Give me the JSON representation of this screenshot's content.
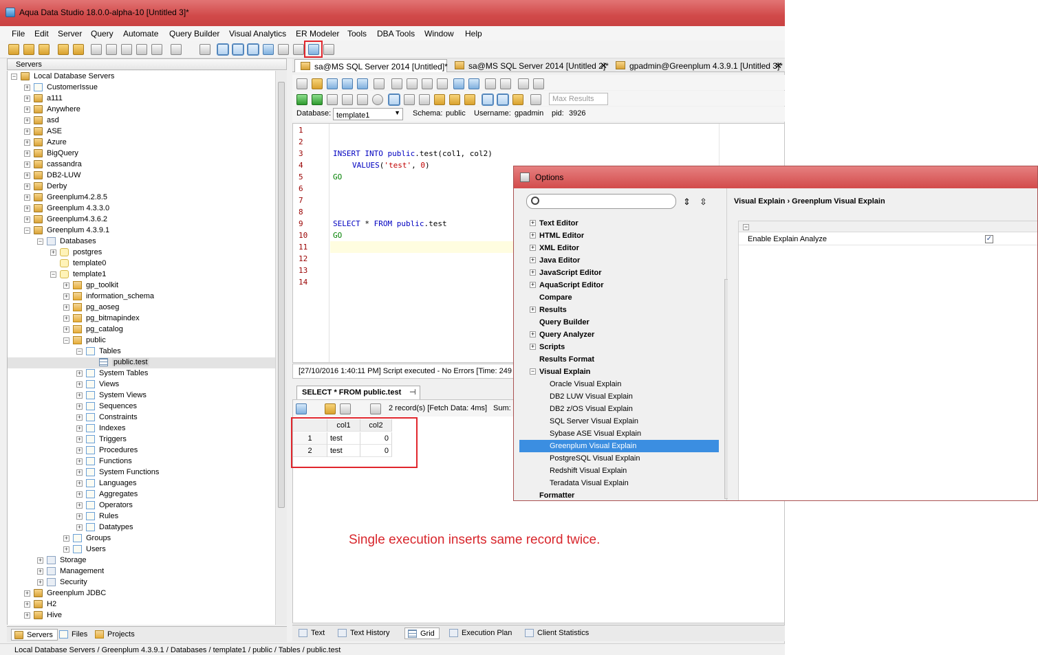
{
  "window": {
    "title": "Aqua Data Studio 18.0.0-alpha-10 [Untitled 3]*"
  },
  "menu": [
    "File",
    "Edit",
    "Server",
    "Query",
    "Automate",
    "Query Builder",
    "Visual Analytics",
    "ER Modeler",
    "Tools",
    "DBA Tools",
    "Window",
    "Help"
  ],
  "left_panel": {
    "header": "Servers",
    "tree": [
      {
        "label": "Local Database Servers",
        "level": 0,
        "icon": "server-group"
      },
      {
        "label": "CustomerIssue",
        "level": 1,
        "icon": "folder"
      },
      {
        "label": "a111",
        "level": 1,
        "icon": "server"
      },
      {
        "label": "Anywhere",
        "level": 1,
        "icon": "server"
      },
      {
        "label": "asd",
        "level": 1,
        "icon": "server"
      },
      {
        "label": "ASE",
        "level": 1,
        "icon": "server"
      },
      {
        "label": "Azure",
        "level": 1,
        "icon": "server"
      },
      {
        "label": "BigQuery",
        "level": 1,
        "icon": "server"
      },
      {
        "label": "cassandra",
        "level": 1,
        "icon": "server"
      },
      {
        "label": "DB2-LUW",
        "level": 1,
        "icon": "server"
      },
      {
        "label": "Derby",
        "level": 1,
        "icon": "server"
      },
      {
        "label": "Greenplum4.2.8.5",
        "level": 1,
        "icon": "server"
      },
      {
        "label": "Greenplum 4.3.3.0",
        "level": 1,
        "icon": "server"
      },
      {
        "label": "Greenplum4.3.6.2",
        "level": 1,
        "icon": "server"
      },
      {
        "label": "Greenplum 4.3.9.1",
        "level": 1,
        "icon": "server"
      },
      {
        "label": "Databases",
        "level": 2,
        "icon": "generic"
      },
      {
        "label": "postgres",
        "level": 3,
        "icon": "database"
      },
      {
        "label": "template0",
        "level": 3,
        "icon": "database"
      },
      {
        "label": "template1",
        "level": 3,
        "icon": "database"
      },
      {
        "label": "gp_toolkit",
        "level": 4,
        "icon": "schema"
      },
      {
        "label": "information_schema",
        "level": 4,
        "icon": "schema"
      },
      {
        "label": "pg_aoseg",
        "level": 4,
        "icon": "schema"
      },
      {
        "label": "pg_bitmapindex",
        "level": 4,
        "icon": "schema"
      },
      {
        "label": "pg_catalog",
        "level": 4,
        "icon": "schema"
      },
      {
        "label": "public",
        "level": 4,
        "icon": "schema"
      },
      {
        "label": "Tables",
        "level": 5,
        "icon": "folder"
      },
      {
        "label": "public.test",
        "level": 6,
        "icon": "table"
      },
      {
        "label": "System Tables",
        "level": 5,
        "icon": "folder"
      },
      {
        "label": "Views",
        "level": 5,
        "icon": "folder"
      },
      {
        "label": "System Views",
        "level": 5,
        "icon": "folder"
      },
      {
        "label": "Sequences",
        "level": 5,
        "icon": "folder"
      },
      {
        "label": "Constraints",
        "level": 5,
        "icon": "folder"
      },
      {
        "label": "Indexes",
        "level": 5,
        "icon": "folder"
      },
      {
        "label": "Triggers",
        "level": 5,
        "icon": "folder"
      },
      {
        "label": "Procedures",
        "level": 5,
        "icon": "folder"
      },
      {
        "label": "Functions",
        "level": 5,
        "icon": "folder"
      },
      {
        "label": "System Functions",
        "level": 5,
        "icon": "folder"
      },
      {
        "label": "Languages",
        "level": 5,
        "icon": "folder"
      },
      {
        "label": "Aggregates",
        "level": 5,
        "icon": "folder"
      },
      {
        "label": "Operators",
        "level": 5,
        "icon": "folder"
      },
      {
        "label": "Rules",
        "level": 5,
        "icon": "folder"
      },
      {
        "label": "Datatypes",
        "level": 5,
        "icon": "folder"
      },
      {
        "label": "Groups",
        "level": 4,
        "icon": "folder"
      },
      {
        "label": "Users",
        "level": 4,
        "icon": "folder"
      },
      {
        "label": "Storage",
        "level": 2,
        "icon": "generic"
      },
      {
        "label": "Management",
        "level": 2,
        "icon": "generic"
      },
      {
        "label": "Security",
        "level": 2,
        "icon": "generic"
      },
      {
        "label": "Greenplum JDBC",
        "level": 1,
        "icon": "server"
      },
      {
        "label": "H2",
        "level": 1,
        "icon": "server"
      },
      {
        "label": "Hive",
        "level": 1,
        "icon": "server"
      }
    ],
    "selected": "public.test",
    "bottom_tabs": [
      "Servers",
      "Files",
      "Projects"
    ]
  },
  "editor_tabs": [
    {
      "label": "sa@MS SQL Server 2014 [Untitled]*"
    },
    {
      "label": "sa@MS SQL Server 2014 [Untitled 2]*"
    },
    {
      "label": "gpadmin@Greenplum 4.3.9.1 [Untitled 3]*"
    }
  ],
  "query_toolbar": {
    "max_results_placeholder": "Max Results"
  },
  "connection": {
    "database_label": "Database:",
    "database": "template1",
    "schema_label": "Schema:",
    "schema": "public",
    "username_label": "Username:",
    "username": "gpadmin",
    "pid_label": "pid:",
    "pid": "3926"
  },
  "editor": {
    "line_numbers": [
      "1",
      "2",
      "3",
      "4",
      "5",
      "6",
      "7",
      "8",
      "9",
      "10",
      "11",
      "12",
      "13",
      "14"
    ],
    "code": {
      "l3_kw1": "INSERT INTO ",
      "l3_rest": "public",
      "l3_tail": ".test(col1, col2)",
      "l4_kw": "VALUES",
      "l4_open": "(",
      "l4_str": "'test'",
      "l4_mid": ", ",
      "l4_num": "0",
      "l4_close": ")",
      "l5": "GO",
      "l9_kw": "SELECT",
      "l9_mid": " * ",
      "l9_kw2": "FROM",
      "l9_sp": " ",
      "l9_rest": "public",
      "l9_tail": ".test",
      "l10": "GO"
    }
  },
  "message": "[27/10/2016 1:40:11 PM] Script executed - No Errors [Time: 249",
  "results": {
    "tab_label": "SELECT * FROM public.test",
    "summary": "2 record(s) [Fetch Data: 4ms]",
    "sum_label": "Sum:",
    "columns": [
      "col1",
      "col2"
    ],
    "rows": [
      {
        "num": "1",
        "col1": "test",
        "col2": "0"
      },
      {
        "num": "2",
        "col1": "test",
        "col2": "0"
      }
    ]
  },
  "result_bottom_tabs": [
    "Text",
    "Text History",
    "Grid",
    "Execution Plan",
    "Client Statistics"
  ],
  "annotation": "Single execution inserts same record twice.",
  "statusbar": "Local Database Servers / Greenplum 4.3.9.1 / Databases / template1 / public / Tables / public.test",
  "options": {
    "title": "Options",
    "categories": [
      {
        "label": "Text Editor",
        "expandable": true
      },
      {
        "label": "HTML Editor",
        "expandable": true
      },
      {
        "label": "XML Editor",
        "expandable": true
      },
      {
        "label": "Java Editor",
        "expandable": true
      },
      {
        "label": "JavaScript Editor",
        "expandable": true
      },
      {
        "label": "AquaScript Editor",
        "expandable": true
      },
      {
        "label": "Compare",
        "expandable": false
      },
      {
        "label": "Results",
        "expandable": true
      },
      {
        "label": "Query Builder",
        "expandable": false
      },
      {
        "label": "Query Analyzer",
        "expandable": true
      },
      {
        "label": "Scripts",
        "expandable": true
      },
      {
        "label": "Results Format",
        "expandable": false
      },
      {
        "label": "Visual Explain",
        "expandable": true,
        "expanded": true
      }
    ],
    "subcategories": [
      "Oracle Visual Explain",
      "DB2 LUW Visual Explain",
      "DB2 z/OS Visual Explain",
      "SQL Server Visual Explain",
      "Sybase ASE Visual Explain",
      "Greenplum Visual Explain",
      "PostgreSQL Visual Explain",
      "Redshift Visual Explain",
      "Teradata Visual Explain"
    ],
    "selected_subcategory": "Greenplum Visual Explain",
    "last_category": "Formatter",
    "breadcrumb": "Visual Explain › Greenplum Visual Explain",
    "property_label": "Enable Explain Analyze",
    "property_checked": "✓"
  },
  "colors": {
    "titlebar": "#d14a4a",
    "annotation": "#d8262c",
    "highlight_box": "#e0252c",
    "selection": "#3b8ee1"
  }
}
